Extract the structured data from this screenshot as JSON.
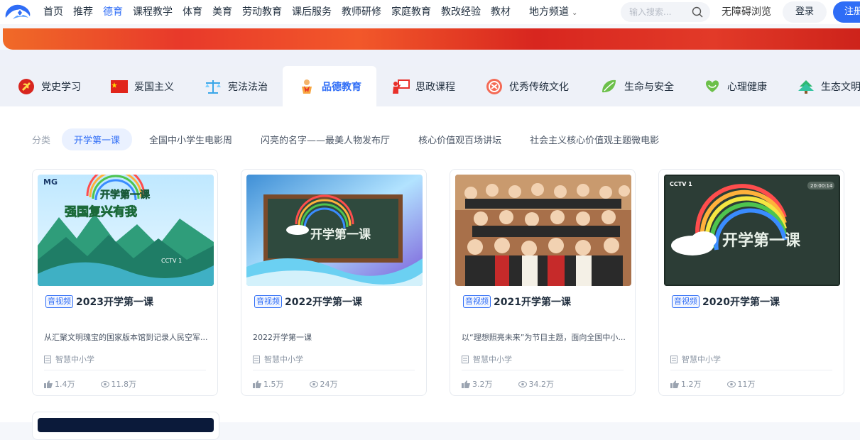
{
  "nav": {
    "links": [
      "首页",
      "推荐",
      "德育",
      "课程教学",
      "体育",
      "美育",
      "劳动教育",
      "课后服务",
      "教师研修",
      "家庭教育",
      "教改经验",
      "教材"
    ],
    "active": "德育",
    "region": "地方频道",
    "search_placeholder": "输入搜索...",
    "accessibility": "无障碍浏览",
    "login": "登录",
    "register": "注册"
  },
  "subject_tabs": [
    {
      "label": "党史学习",
      "icon": "party-emblem-icon"
    },
    {
      "label": "爱国主义",
      "icon": "flag-icon"
    },
    {
      "label": "宪法法治",
      "icon": "scales-icon"
    },
    {
      "label": "品德教育",
      "icon": "scarf-icon",
      "active": true
    },
    {
      "label": "思政课程",
      "icon": "teacher-board-icon"
    },
    {
      "label": "优秀传统文化",
      "icon": "knot-icon"
    },
    {
      "label": "生命与安全",
      "icon": "leaf-icon"
    },
    {
      "label": "心理健康",
      "icon": "heart-icon"
    },
    {
      "label": "生态文明",
      "icon": "tree-icon"
    }
  ],
  "categories": {
    "label": "分类",
    "items": [
      "开学第一课",
      "全国中小学生电影周",
      "闪亮的名字——最美人物发布厅",
      "核心价值观百场讲坛",
      "社会主义核心价值观主题微电影"
    ],
    "active": "开学第一课"
  },
  "cards": [
    {
      "badge": "音视频",
      "title": "2023开学第一课",
      "desc": "从汇聚文明瑰宝的国家版本馆到记录人民空军...",
      "source": "智慧中小学",
      "likes": "1.4万",
      "views": "11.8万"
    },
    {
      "badge": "音视频",
      "title": "2022开学第一课",
      "desc": "2022开学第一课",
      "source": "智慧中小学",
      "likes": "1.5万",
      "views": "24万"
    },
    {
      "badge": "音视频",
      "title": "2021开学第一课",
      "desc": "以“理想照亮未来”为节目主题，面向全国中小...",
      "source": "智慧中小学",
      "likes": "3.2万",
      "views": "34.2万"
    },
    {
      "badge": "音视频",
      "title": "2020开学第一课",
      "desc": "",
      "source": "智慧中小学",
      "likes": "1.2万",
      "views": "11万"
    }
  ],
  "thumb_text": {
    "t1_brand": "MG",
    "t1_title": "开学第一课",
    "t1_sub": "强国复兴有我",
    "t1_channel": "CCTV 1",
    "t2_title": "开学第一课",
    "t4_channel": "CCTV 1",
    "t4_time": "20:00:14",
    "t4_title": "开学第一课"
  },
  "colors": {
    "accent": "#2f6df6",
    "banner": "#e8392a"
  }
}
